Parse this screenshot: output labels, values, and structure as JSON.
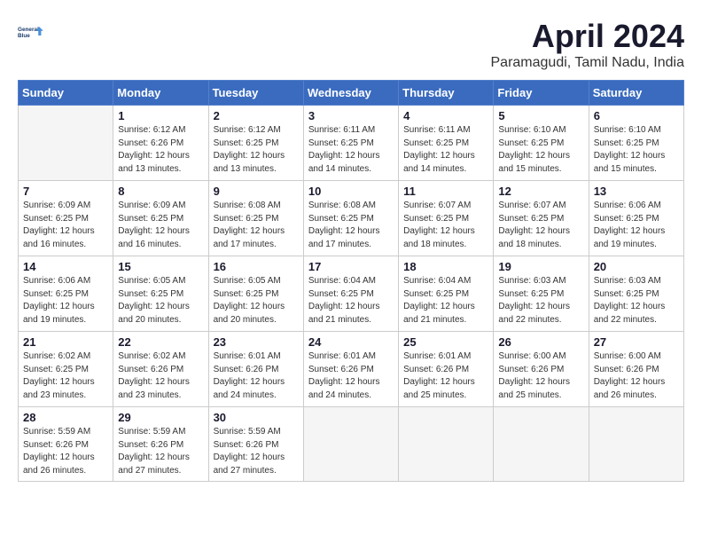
{
  "header": {
    "logo_line1": "General",
    "logo_line2": "Blue",
    "month": "April 2024",
    "location": "Paramagudi, Tamil Nadu, India"
  },
  "days_of_week": [
    "Sunday",
    "Monday",
    "Tuesday",
    "Wednesday",
    "Thursday",
    "Friday",
    "Saturday"
  ],
  "weeks": [
    [
      {
        "day": "",
        "empty": true
      },
      {
        "day": "1",
        "sunrise": "6:12 AM",
        "sunset": "6:26 PM",
        "daylight": "12 hours and 13 minutes."
      },
      {
        "day": "2",
        "sunrise": "6:12 AM",
        "sunset": "6:25 PM",
        "daylight": "12 hours and 13 minutes."
      },
      {
        "day": "3",
        "sunrise": "6:11 AM",
        "sunset": "6:25 PM",
        "daylight": "12 hours and 14 minutes."
      },
      {
        "day": "4",
        "sunrise": "6:11 AM",
        "sunset": "6:25 PM",
        "daylight": "12 hours and 14 minutes."
      },
      {
        "day": "5",
        "sunrise": "6:10 AM",
        "sunset": "6:25 PM",
        "daylight": "12 hours and 15 minutes."
      },
      {
        "day": "6",
        "sunrise": "6:10 AM",
        "sunset": "6:25 PM",
        "daylight": "12 hours and 15 minutes."
      }
    ],
    [
      {
        "day": "7",
        "sunrise": "6:09 AM",
        "sunset": "6:25 PM",
        "daylight": "12 hours and 16 minutes."
      },
      {
        "day": "8",
        "sunrise": "6:09 AM",
        "sunset": "6:25 PM",
        "daylight": "12 hours and 16 minutes."
      },
      {
        "day": "9",
        "sunrise": "6:08 AM",
        "sunset": "6:25 PM",
        "daylight": "12 hours and 17 minutes."
      },
      {
        "day": "10",
        "sunrise": "6:08 AM",
        "sunset": "6:25 PM",
        "daylight": "12 hours and 17 minutes."
      },
      {
        "day": "11",
        "sunrise": "6:07 AM",
        "sunset": "6:25 PM",
        "daylight": "12 hours and 18 minutes."
      },
      {
        "day": "12",
        "sunrise": "6:07 AM",
        "sunset": "6:25 PM",
        "daylight": "12 hours and 18 minutes."
      },
      {
        "day": "13",
        "sunrise": "6:06 AM",
        "sunset": "6:25 PM",
        "daylight": "12 hours and 19 minutes."
      }
    ],
    [
      {
        "day": "14",
        "sunrise": "6:06 AM",
        "sunset": "6:25 PM",
        "daylight": "12 hours and 19 minutes."
      },
      {
        "day": "15",
        "sunrise": "6:05 AM",
        "sunset": "6:25 PM",
        "daylight": "12 hours and 20 minutes."
      },
      {
        "day": "16",
        "sunrise": "6:05 AM",
        "sunset": "6:25 PM",
        "daylight": "12 hours and 20 minutes."
      },
      {
        "day": "17",
        "sunrise": "6:04 AM",
        "sunset": "6:25 PM",
        "daylight": "12 hours and 21 minutes."
      },
      {
        "day": "18",
        "sunrise": "6:04 AM",
        "sunset": "6:25 PM",
        "daylight": "12 hours and 21 minutes."
      },
      {
        "day": "19",
        "sunrise": "6:03 AM",
        "sunset": "6:25 PM",
        "daylight": "12 hours and 22 minutes."
      },
      {
        "day": "20",
        "sunrise": "6:03 AM",
        "sunset": "6:25 PM",
        "daylight": "12 hours and 22 minutes."
      }
    ],
    [
      {
        "day": "21",
        "sunrise": "6:02 AM",
        "sunset": "6:25 PM",
        "daylight": "12 hours and 23 minutes."
      },
      {
        "day": "22",
        "sunrise": "6:02 AM",
        "sunset": "6:26 PM",
        "daylight": "12 hours and 23 minutes."
      },
      {
        "day": "23",
        "sunrise": "6:01 AM",
        "sunset": "6:26 PM",
        "daylight": "12 hours and 24 minutes."
      },
      {
        "day": "24",
        "sunrise": "6:01 AM",
        "sunset": "6:26 PM",
        "daylight": "12 hours and 24 minutes."
      },
      {
        "day": "25",
        "sunrise": "6:01 AM",
        "sunset": "6:26 PM",
        "daylight": "12 hours and 25 minutes."
      },
      {
        "day": "26",
        "sunrise": "6:00 AM",
        "sunset": "6:26 PM",
        "daylight": "12 hours and 25 minutes."
      },
      {
        "day": "27",
        "sunrise": "6:00 AM",
        "sunset": "6:26 PM",
        "daylight": "12 hours and 26 minutes."
      }
    ],
    [
      {
        "day": "28",
        "sunrise": "5:59 AM",
        "sunset": "6:26 PM",
        "daylight": "12 hours and 26 minutes."
      },
      {
        "day": "29",
        "sunrise": "5:59 AM",
        "sunset": "6:26 PM",
        "daylight": "12 hours and 27 minutes."
      },
      {
        "day": "30",
        "sunrise": "5:59 AM",
        "sunset": "6:26 PM",
        "daylight": "12 hours and 27 minutes."
      },
      {
        "day": "",
        "empty": true
      },
      {
        "day": "",
        "empty": true
      },
      {
        "day": "",
        "empty": true
      },
      {
        "day": "",
        "empty": true
      }
    ]
  ]
}
